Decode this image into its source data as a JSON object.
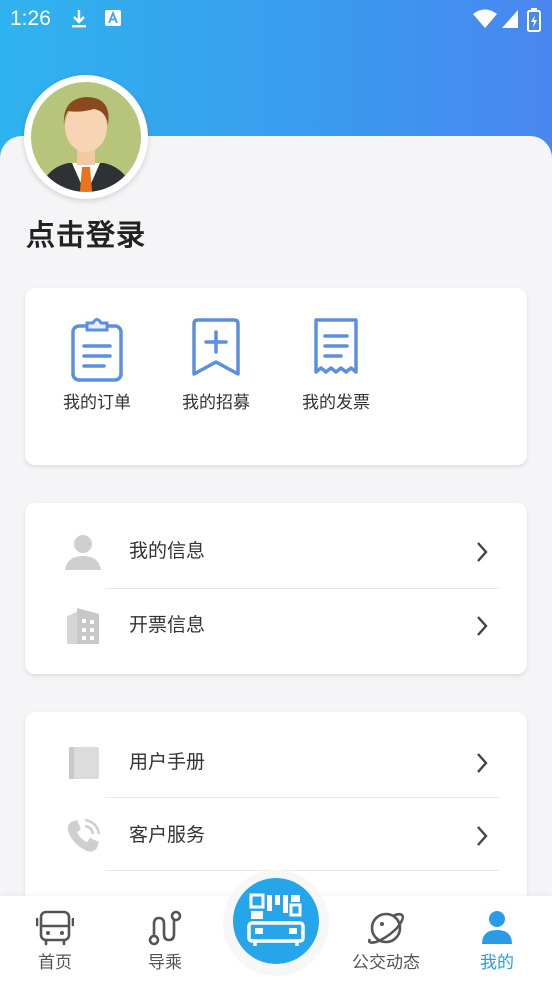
{
  "status_bar": {
    "time": "1:26"
  },
  "profile": {
    "login_text": "点击登录"
  },
  "quick_actions": [
    {
      "label": "我的订单",
      "icon": "clipboard-icon"
    },
    {
      "label": "我的招募",
      "icon": "bookmark-plus-icon"
    },
    {
      "label": "我的发票",
      "icon": "receipt-icon"
    }
  ],
  "info_menu": [
    {
      "label": "我的信息",
      "icon": "user-icon"
    },
    {
      "label": "开票信息",
      "icon": "building-icon"
    }
  ],
  "support_menu": [
    {
      "label": "用户手册",
      "icon": "book-icon"
    },
    {
      "label": "客户服务",
      "icon": "phone-icon"
    }
  ],
  "tabbar": {
    "items": [
      {
        "label": "首页",
        "icon": "bus-icon"
      },
      {
        "label": "导乘",
        "icon": "route-icon"
      },
      {
        "label": "公交动态",
        "icon": "planet-icon"
      },
      {
        "label": "我的",
        "icon": "user-icon"
      }
    ],
    "active": "我的",
    "center_icon": "qr-bus-icon"
  },
  "colors": {
    "accent": "#2a9be8",
    "header_from": "#2fb3ee",
    "header_to": "#4a86ef",
    "icon_blue": "#5b8fe0",
    "icon_gray": "#c8c8c8"
  }
}
